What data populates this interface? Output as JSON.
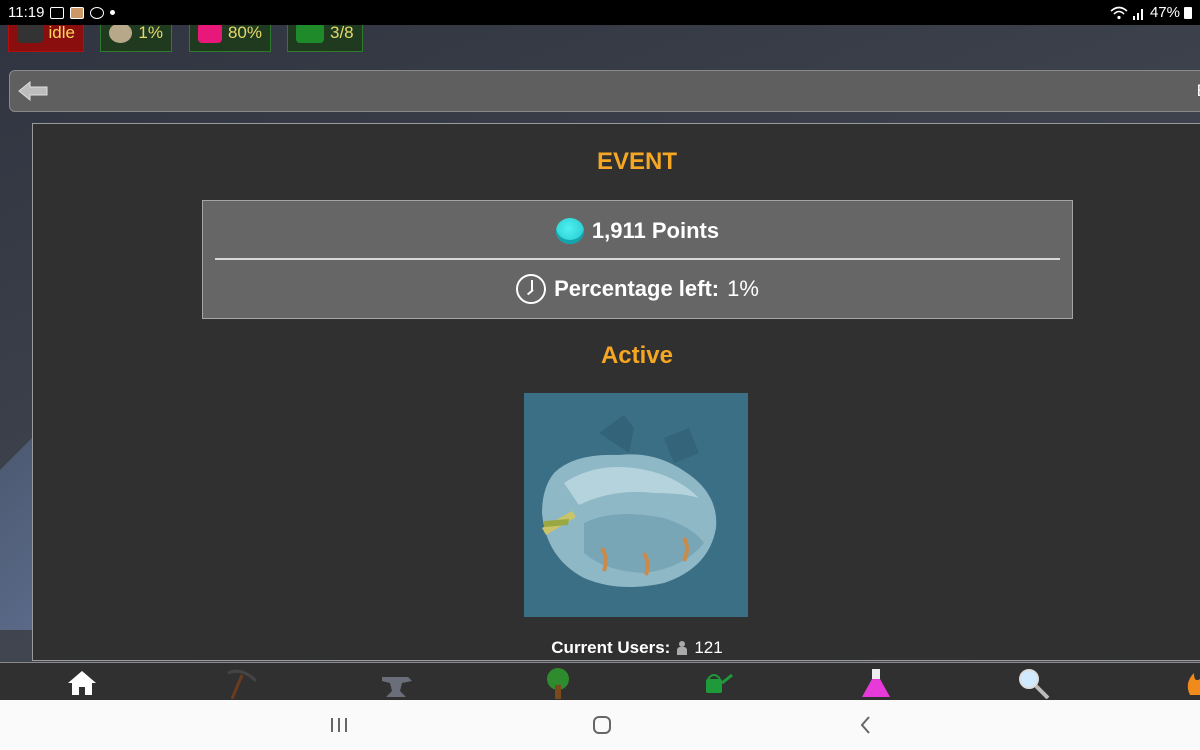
{
  "statusbar": {
    "time": "11:19",
    "battery": "47%"
  },
  "resources": [
    {
      "label": "idle",
      "icon": "ore-cart-icon"
    },
    {
      "label": "1%",
      "icon": "rock-icon"
    },
    {
      "label": "80%",
      "icon": "furnace-icon"
    },
    {
      "label": "3/8",
      "icon": "tractor-icon"
    }
  ],
  "navbar": {
    "back_icon": "back-arrow-icon",
    "cut_text": "E"
  },
  "event": {
    "title": "EVENT",
    "points": "1,911 Points",
    "percentage_label": "Percentage left:",
    "percentage_value": "1%",
    "status": "Active",
    "users_label": "Current Users:",
    "users_count": "121"
  },
  "toolbar": {
    "items": [
      "home-icon",
      "pickaxe-icon",
      "anvil-icon",
      "tree-icon",
      "watering-can-icon",
      "flask-icon",
      "magnifier-icon",
      "campfire-icon"
    ]
  },
  "colors": {
    "accent": "#f5a623",
    "panel": "#303030",
    "info_box": "#666666",
    "coin": "#2fd6dc"
  }
}
